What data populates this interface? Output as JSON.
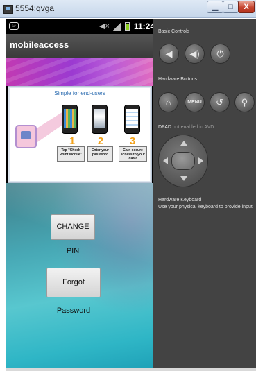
{
  "window": {
    "title": "5554:qvga",
    "minimize_glyph": "▁",
    "maximize_glyph": "□",
    "close_glyph": "X"
  },
  "statusbar": {
    "time": "11:24",
    "icons": [
      "usb-debug-icon",
      "mute-icon",
      "signal-icon",
      "battery-icon"
    ]
  },
  "app": {
    "title": "mobileaccess",
    "info_panel": {
      "title": "Simple for end-users",
      "steps": [
        {
          "number": "1",
          "text": "Tap \"Check Point Mobile\""
        },
        {
          "number": "2",
          "text": "Enter your password"
        },
        {
          "number": "3",
          "text": "Gain secure access to your data!"
        }
      ]
    },
    "change_pin_label": "CHANGE PIN",
    "forgot_password_label": "Forgot Password"
  },
  "controls": {
    "basic_label": "Basic Controls",
    "basic_buttons": [
      {
        "name": "volume-down",
        "glyph": "◀"
      },
      {
        "name": "volume-up",
        "glyph": "◀)"
      },
      {
        "name": "power",
        "glyph": "⏻"
      }
    ],
    "hardware_label": "Hardware Buttons",
    "hardware_buttons": [
      {
        "name": "home",
        "glyph": "⌂"
      },
      {
        "name": "menu",
        "glyph": "MENU"
      },
      {
        "name": "back",
        "glyph": "↺"
      },
      {
        "name": "search",
        "glyph": "⚲"
      }
    ],
    "dpad_label": "DPAD",
    "dpad_note": "not enabled in AVD",
    "keyboard_title": "Hardware Keyboard",
    "keyboard_desc": "Use your physical keyboard to provide input"
  },
  "colors": {
    "panel_bg": "#434343",
    "appbar_bg": "#444444",
    "banner_accent": "#b23fd0",
    "step_number": "#f2a31d",
    "content_teal": "#47a8b5"
  }
}
